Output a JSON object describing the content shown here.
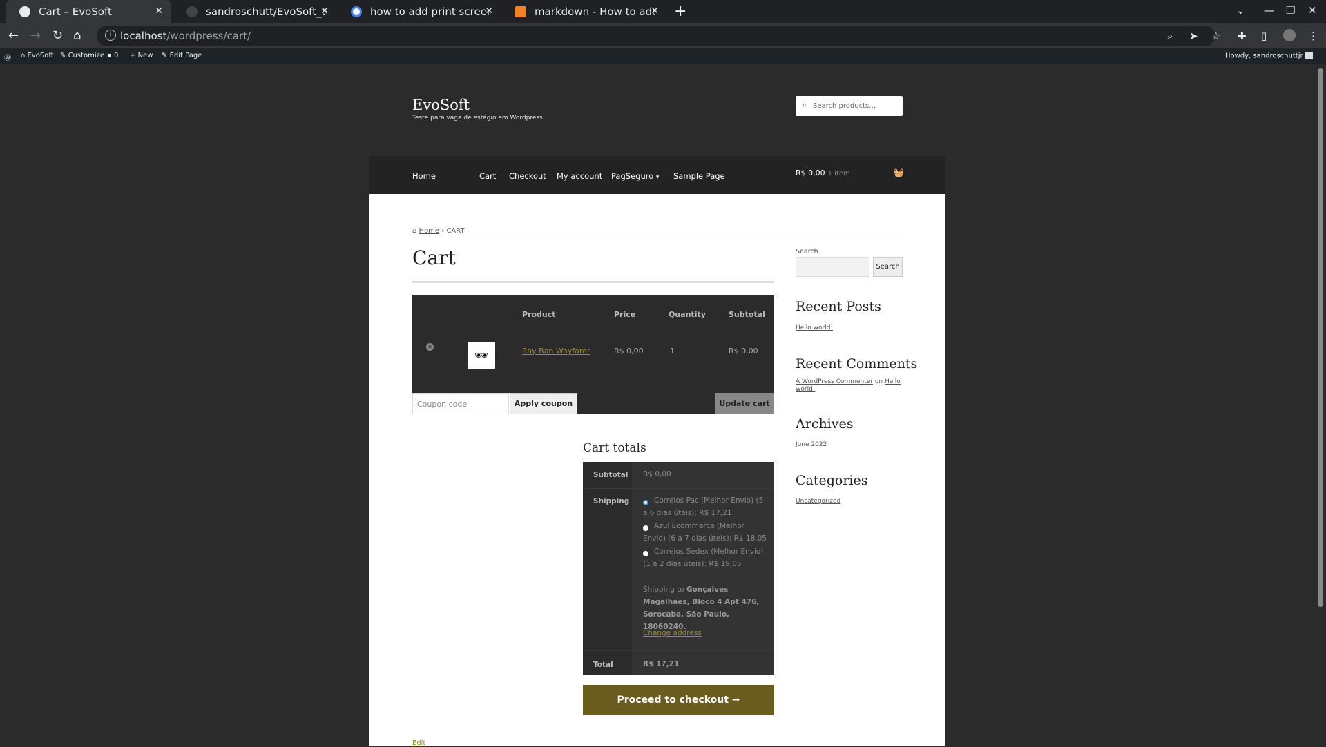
{
  "browser": {
    "tabs": [
      {
        "title": "Cart – EvoSoft",
        "active": true,
        "icon": "wordpress-icon"
      },
      {
        "title": "sandroschutt/EvoSoft_teste_v",
        "active": false,
        "icon": "github-icon"
      },
      {
        "title": "how to add print screenshot t",
        "active": false,
        "icon": "google-icon"
      },
      {
        "title": "markdown - How to add scree",
        "active": false,
        "icon": "stackoverflow-icon"
      }
    ],
    "url_host": "localhost",
    "url_path": "/wordpress/cart/"
  },
  "wp_admin_bar": {
    "site": "EvoSoft",
    "customize": "Customize",
    "comments": "0",
    "new": "New",
    "edit_page": "Edit Page",
    "howdy": "Howdy, sandroschuttjr"
  },
  "site": {
    "title": "EvoSoft",
    "tagline": "Teste para vaga de estágio em Wordpress",
    "search_placeholder": "Search products…"
  },
  "nav": {
    "items": [
      "Home",
      "Cart",
      "Checkout",
      "My account",
      "PagSeguro",
      "Sample Page"
    ],
    "cart_total": "R$ 0,00",
    "cart_count": "1 item"
  },
  "breadcrumb": {
    "home": "Home",
    "current": "CART"
  },
  "page_title": "Cart",
  "cart_table": {
    "headers": {
      "product": "Product",
      "price": "Price",
      "quantity": "Quantity",
      "subtotal": "Subtotal"
    },
    "rows": [
      {
        "product": "Ray Ban Wayfarer",
        "price": "R$ 0,00",
        "quantity": "1",
        "subtotal": "R$ 0,00"
      }
    ]
  },
  "coupon": {
    "placeholder": "Coupon code",
    "apply_label": "Apply coupon",
    "update_label": "Update cart"
  },
  "totals": {
    "heading": "Cart totals",
    "subtotal_label": "Subtotal",
    "subtotal_value": "R$ 0,00",
    "shipping_label": "Shipping",
    "shipping_options": [
      {
        "label": "Correios Pac (Melhor Envio) (5 a 6 dias úteis): R$ 17,21",
        "selected": true
      },
      {
        "label": "Azul Ecommerce (Melhor Envio) (6 a 7 dias úteis): R$ 18,05",
        "selected": false
      },
      {
        "label": "Correios Sedex (Melhor Envio) (1 a 2 dias úteis): R$ 19,05",
        "selected": false
      }
    ],
    "shipping_to_prefix": "Shipping to",
    "shipping_to_address": "Gonçalves Magalhães, Bloco 4 Apt 476, Sorocaba, São Paulo, 18060240.",
    "change_address": "Change address",
    "total_label": "Total",
    "total_value": "R$ 17,21",
    "proceed_label": "Proceed to checkout ➞"
  },
  "edit_link": "Edit",
  "sidebar": {
    "search_label": "Search",
    "search_button": "Search",
    "recent_posts_title": "Recent Posts",
    "recent_posts": [
      "Hello world!"
    ],
    "recent_comments_title": "Recent Comments",
    "comment_author": "A WordPress Commenter",
    "comment_on": "on",
    "comment_post": "Hello world!",
    "archives_title": "Archives",
    "archives": [
      "June 2022"
    ],
    "categories_title": "Categories",
    "categories": [
      "Uncategorized"
    ]
  },
  "colors": {
    "accent": "#6a5c1e",
    "link": "#9a8a3a",
    "dark_bg": "#2b2b2b"
  }
}
